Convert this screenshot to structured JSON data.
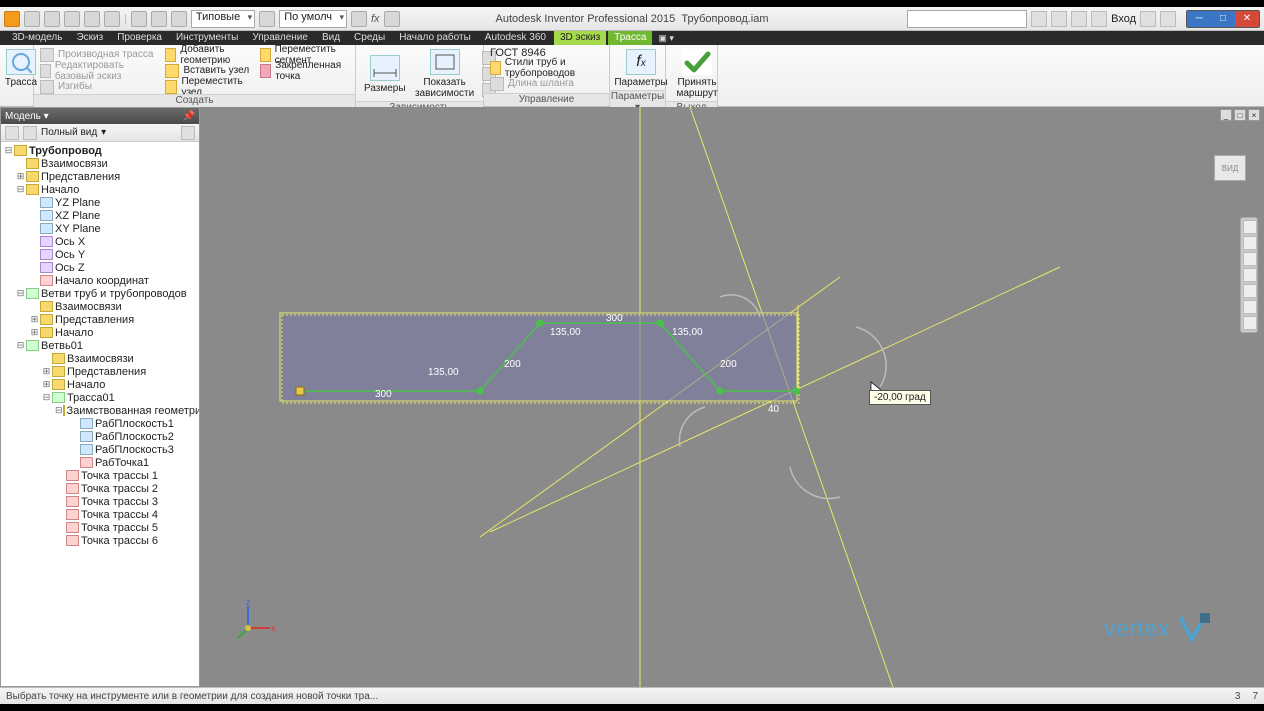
{
  "title": {
    "app": "Autodesk Inventor Professional 2015",
    "doc": "Трубопровод.iam"
  },
  "qat": {
    "combo1": "Типовые",
    "combo2": "По умолч",
    "fx": "fx",
    "user": "Вход"
  },
  "menu": {
    "items": [
      "3D-модель",
      "Эскиз",
      "Проверка",
      "Инструменты",
      "Управление",
      "Вид",
      "Среды",
      "Начало работы",
      "Autodesk 360"
    ],
    "active1": "3D эскиз",
    "active2": "Трасса"
  },
  "ribbon": {
    "trass": "Трасса",
    "create": {
      "derived": "Производная трасса",
      "editbase": "Редактировать базовый эскиз",
      "bends": "Изгибы",
      "addgeo": "Добавить геометрию",
      "insertnode": "Вставить узел",
      "movenode": "Переместить узел",
      "movesegment": "Переместить сегмент",
      "fixedpoint": "Закрепленная точка",
      "label": "Создать"
    },
    "constraint": {
      "dims": "Размеры",
      "showdeps": "Показать зависимости",
      "label": "Зависимость"
    },
    "manage": {
      "combo": "ГОСТ 8946",
      "styles": "Стили труб и трубопроводов",
      "hose": "Длина шланга",
      "label": "Управление"
    },
    "params": {
      "btn": "Параметры",
      "label": "Параметры ▾"
    },
    "exit": {
      "accept": "Принять маршрут",
      "label": "Выход"
    }
  },
  "browser": {
    "header": "Модель ▾",
    "filter": "Полный вид",
    "root": "Трубопровод",
    "nodes": {
      "rel": "Взаимосвязи",
      "repr": "Представления",
      "origin": "Начало",
      "yz": "YZ Plane",
      "xz": "XZ Plane",
      "xy": "XY Plane",
      "ox": "Ось X",
      "oy": "Ось Y",
      "oz": "Ось Z",
      "origpt": "Начало координат",
      "pipes": "Ветви труб и трубопроводов",
      "branch": "Ветвь01",
      "route": "Трасса01",
      "borrowed": "Заимствованная геометрия",
      "wp1": "РабПлоскость1",
      "wp2": "РабПлоскость2",
      "wp3": "РабПлоскость3",
      "wpt1": "РабТочка1",
      "rp1": "Точка трассы 1",
      "rp2": "Точка трассы 2",
      "rp3": "Точка трассы 3",
      "rp4": "Точка трассы 4",
      "rp5": "Точка трассы 5",
      "rp6": "Точка трассы 6"
    }
  },
  "canvas": {
    "dims": {
      "d300a": "300",
      "d300b": "300",
      "a135a": "135,00",
      "a135b": "135,00",
      "a135c": "135,00",
      "d200a": "200",
      "d200b": "200",
      "a40": "40"
    },
    "tooltip": "-20,00 град",
    "cube": "ВИД",
    "watermark": "vertex"
  },
  "status": {
    "msg": "Выбрать точку на инструменте или в геометрии для создания новой точки тра...",
    "n1": "3",
    "n2": "7"
  }
}
